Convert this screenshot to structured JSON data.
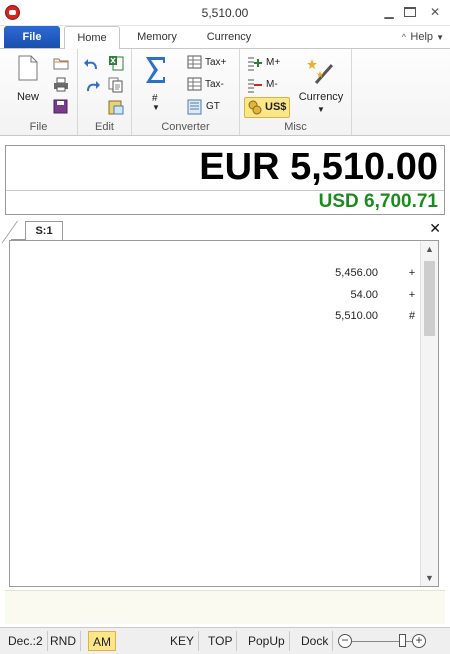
{
  "window": {
    "title": "5,510.00"
  },
  "titlebar_icons": {
    "app": "calculator-app-icon",
    "minimize": "minimize-icon",
    "restore": "restore-icon",
    "close": "close-icon"
  },
  "menu": {
    "file": "File",
    "tabs": [
      "Home",
      "Memory",
      "Currency"
    ],
    "active_tab": "Home",
    "help": "Help"
  },
  "ribbon": {
    "groups": {
      "file": {
        "label": "File",
        "new": "New"
      },
      "edit": {
        "label": "Edit"
      },
      "converter": {
        "label": "Converter",
        "sum_sub": "#",
        "tax_plus": "Tax+",
        "tax_minus": "Tax-",
        "gt": "GT"
      },
      "misc": {
        "label": "Misc",
        "m_plus": "M+",
        "m_minus": "M-",
        "us": "US$",
        "currency": "Currency"
      }
    }
  },
  "display": {
    "main": "EUR 5,510.00",
    "secondary": "USD 6,700.71",
    "secondary_color": "#1c8a1c"
  },
  "tape": {
    "tab": "S:1",
    "rows": [
      {
        "value": "5,456.00",
        "op": "+"
      },
      {
        "value": "54.00",
        "op": "+"
      },
      {
        "value": "5,510.00",
        "op": "#"
      }
    ]
  },
  "statusbar": {
    "items": [
      "Dec.:2",
      "RND",
      "AM",
      "KEY",
      "TOP",
      "PopUp",
      "Dock"
    ],
    "active": "AM",
    "zoom_out": "−",
    "zoom_in": "+"
  },
  "colors": {
    "file_tab": "#1a4fae",
    "highlight": "#fde58a",
    "secondary_display": "#1c8a1c"
  }
}
